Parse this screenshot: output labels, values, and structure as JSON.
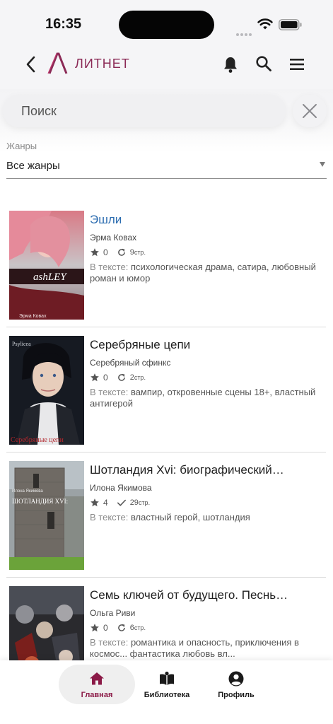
{
  "status_bar": {
    "time": "16:35"
  },
  "header": {
    "logo_text": "ЛИТНЕТ",
    "accent_color": "#8b2a56"
  },
  "search": {
    "placeholder": "Поиск",
    "value": ""
  },
  "filters": {
    "genre_label": "Жанры",
    "genre_value": "Все жанры"
  },
  "books": [
    {
      "title": "Эшли",
      "author": "Эрма Ковах",
      "rating": "0",
      "pages": "9",
      "pages_unit": "стр.",
      "status_icon": "refresh-icon",
      "tags_prefix": "В тексте:",
      "tags": "психологическая драма, сатира, любовный роман и юмор",
      "cover_text": "ashLEY",
      "cover_author": "Эрма Ковах"
    },
    {
      "title": "Серебряные цепи",
      "author": "Серебряный сфинкс",
      "rating": "0",
      "pages": "2",
      "pages_unit": "стр.",
      "status_icon": "refresh-icon",
      "tags_prefix": "В тексте:",
      "tags": "вампир, откровенные сцены 18+, властный антигерой",
      "cover_text": "Серебряные цепи",
      "cover_top": "Psylicea"
    },
    {
      "title": "Шотландия Xvi: биографический…",
      "author": "Илона Якимова",
      "rating": "4",
      "pages": "29",
      "pages_unit": "стр.",
      "status_icon": "check-icon",
      "tags_prefix": "В тексте:",
      "tags": "властный герой, шотландия",
      "cover_text": "ШОТЛАНДИЯ XVI:",
      "cover_author": "Илона Якимова"
    },
    {
      "title": "Семь ключей от будущего. Песнь…",
      "author": "Ольга Риви",
      "rating": "0",
      "pages": "6",
      "pages_unit": "стр.",
      "status_icon": "refresh-icon",
      "tags_prefix": "В тексте:",
      "tags": "романтика и опасность, приключения в космос... фантастика любовь вл..."
    }
  ],
  "bottom_nav": {
    "items": [
      {
        "label": "Главная",
        "icon": "home-icon",
        "active": true
      },
      {
        "label": "Библиотека",
        "icon": "book-icon",
        "active": false
      },
      {
        "label": "Профиль",
        "icon": "profile-icon",
        "active": false
      }
    ]
  }
}
